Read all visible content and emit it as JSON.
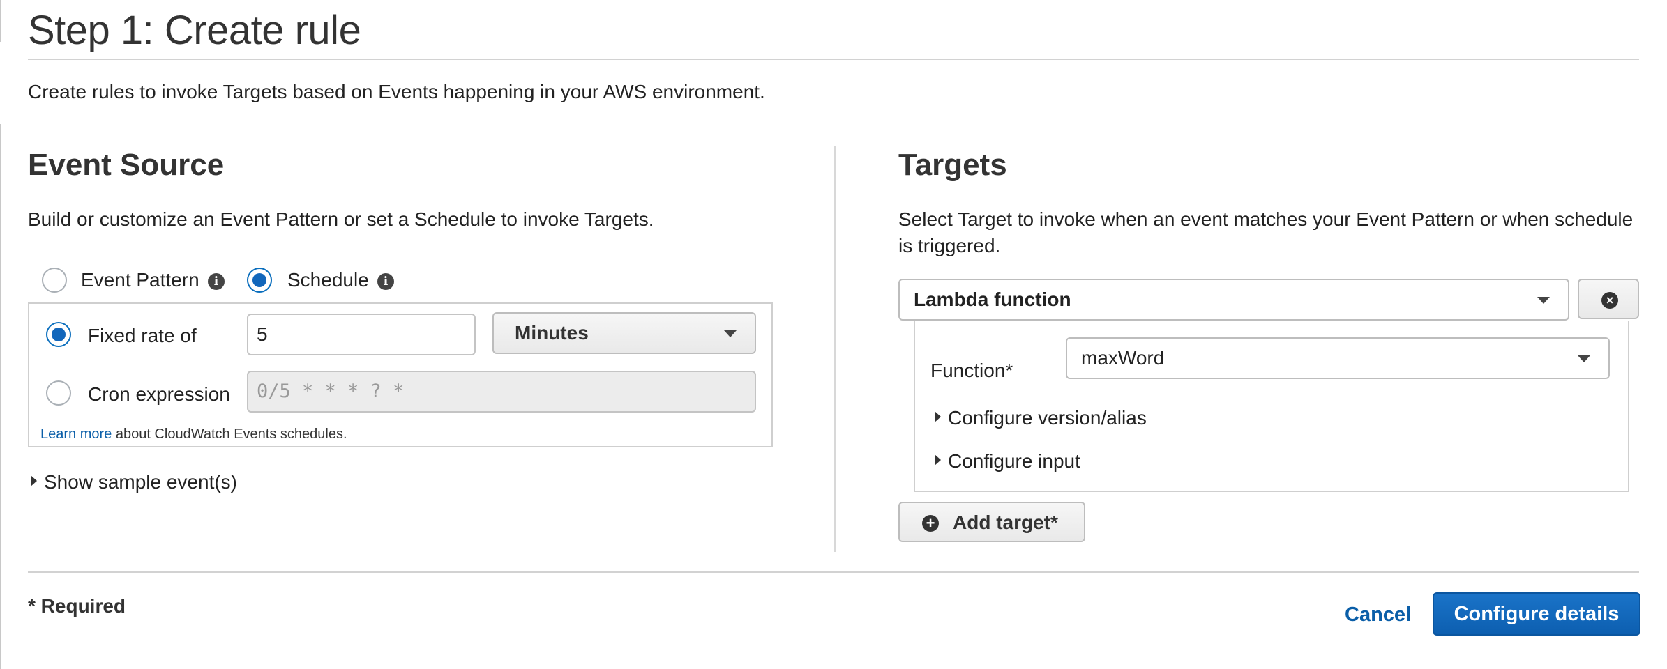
{
  "header": {
    "title": "Step 1: Create rule",
    "description": "Create rules to invoke Targets based on Events happening in your AWS environment."
  },
  "event_source": {
    "heading": "Event Source",
    "description": "Build or customize an Event Pattern or set a Schedule to invoke Targets.",
    "mode_options": [
      {
        "label": "Event Pattern",
        "selected": false
      },
      {
        "label": "Schedule",
        "selected": true
      }
    ],
    "schedule": {
      "fixed_rate": {
        "label": "Fixed rate of",
        "selected": true,
        "value": "5",
        "unit": "Minutes"
      },
      "cron": {
        "label": "Cron expression",
        "selected": false,
        "placeholder": "0/5 * * * ? *"
      },
      "learn_more_link": "Learn more",
      "learn_more_text": " about CloudWatch Events schedules."
    },
    "show_sample": "Show sample event(s)"
  },
  "targets": {
    "heading": "Targets",
    "description_line1": "Select Target to invoke when an event matches your Event Pattern or when schedule",
    "description_line2": "is triggered.",
    "target_type": "Lambda function",
    "function_label": "Function*",
    "function_value": "maxWord",
    "configure_version": "Configure version/alias",
    "configure_input": "Configure input",
    "add_target": "Add target*"
  },
  "footer": {
    "required_note": "* Required",
    "cancel": "Cancel",
    "configure_details": "Configure details"
  },
  "colors": {
    "primary": "#1166bb",
    "link": "#0a5ea8"
  },
  "icons": {
    "info": "info-circle-icon",
    "remove": "x-circle-icon",
    "add": "plus-circle-icon",
    "dropdown": "caret-down-icon",
    "expand": "triangle-right-icon"
  }
}
